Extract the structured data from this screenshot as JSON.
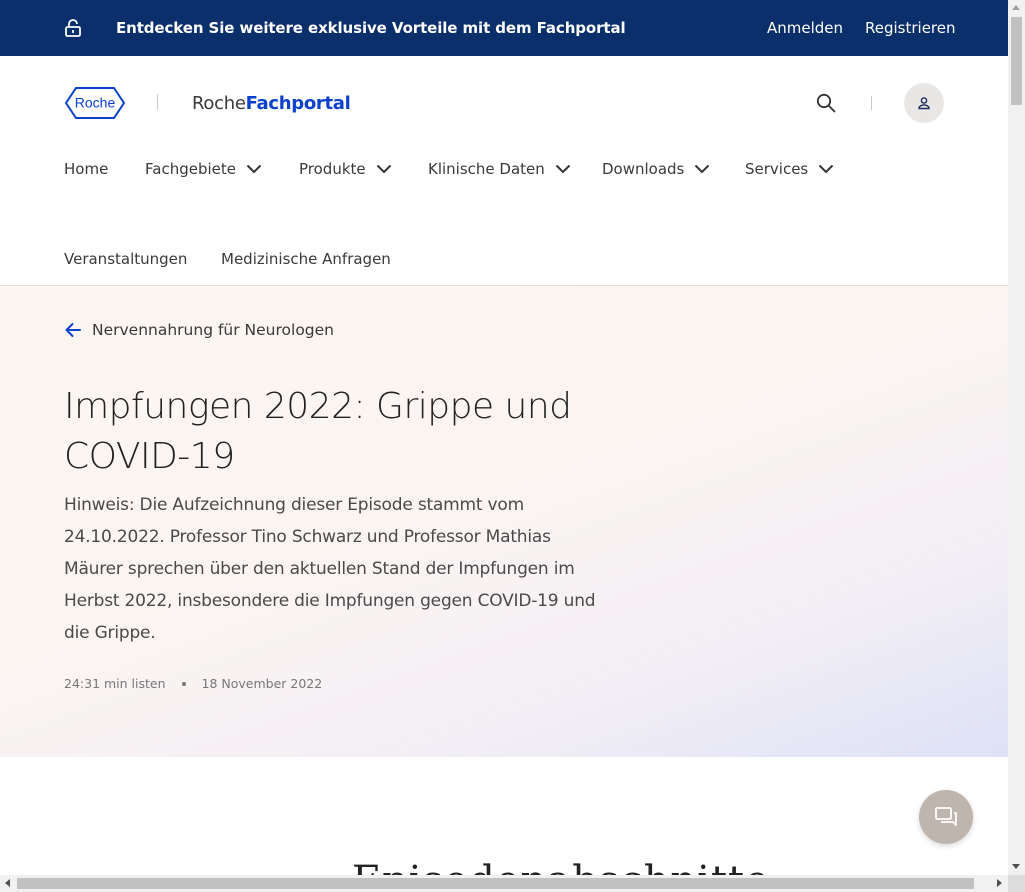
{
  "topbar": {
    "promo_text": "Entdecken Sie weitere exklusive Vorteile mit dem Fachportal",
    "login_label": "Anmelden",
    "register_label": "Registrieren",
    "background_color": "#0b2f6b"
  },
  "header": {
    "logo_text": "Roche",
    "brand_part1": "Roche",
    "brand_part2": "Fachportal",
    "brand_color": "#0b41cd"
  },
  "nav": {
    "items": [
      {
        "label": "Home",
        "has_dropdown": false
      },
      {
        "label": "Fachgebiete",
        "has_dropdown": true
      },
      {
        "label": "Produkte",
        "has_dropdown": true
      },
      {
        "label": "Klinische Daten",
        "has_dropdown": true
      },
      {
        "label": "Downloads",
        "has_dropdown": true
      },
      {
        "label": "Services",
        "has_dropdown": true
      },
      {
        "label": "Veranstaltungen",
        "has_dropdown": false
      },
      {
        "label": "Medizinische Anfragen",
        "has_dropdown": false
      }
    ]
  },
  "hero": {
    "back_label": "Nervennahrung für Neurologen",
    "title": "Impfungen 2022: Grippe und COVID-19",
    "description": "Hinweis: Die Aufzeichnung dieser Episode stammt vom 24.10.2022. Professor Tino Schwarz und Professor Mathias Mäurer sprechen über den aktuellen Stand der Impfungen im Herbst 2022, insbesondere die Impfungen gegen COVID-19 und die Grippe.",
    "duration": "24:31 min listen",
    "date": "18 November 2022"
  },
  "below": {
    "partial_heading": "Episodenabschnitte"
  },
  "icons": {
    "lock": "unlock-icon",
    "search": "search-icon",
    "user": "user-icon",
    "back": "arrow-left-icon",
    "chat": "chat-icon"
  }
}
